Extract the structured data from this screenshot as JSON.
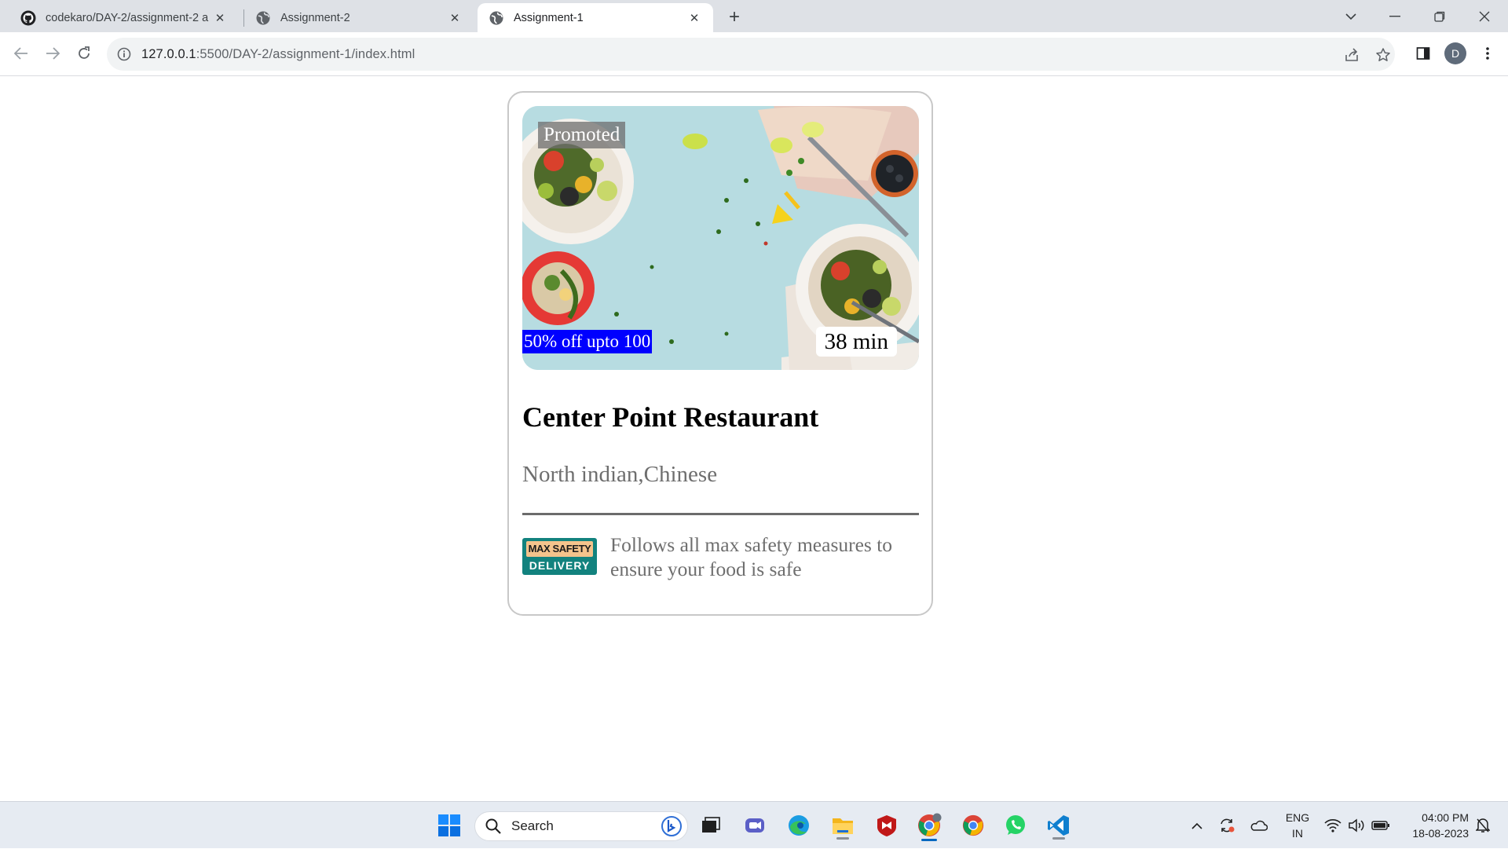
{
  "browser": {
    "tabs": [
      {
        "title": "codekaro/DAY-2/assignment-2 a",
        "icon": "github-icon",
        "active": false
      },
      {
        "title": "Assignment-2",
        "icon": "globe-icon",
        "active": false
      },
      {
        "title": "Assignment-1",
        "icon": "globe-icon",
        "active": true
      }
    ],
    "address": {
      "host": "127.0.0.1",
      "path": ":5500/DAY-2/assignment-1/index.html"
    },
    "profile_initial": "D"
  },
  "card": {
    "promoted_label": "Promoted",
    "offer_label": "50% off upto 100",
    "eta_label": "38 min",
    "restaurant_name": "Center Point Restaurant",
    "cuisines": "North indian,Chinese",
    "badge": {
      "top": "MAX SAFETY",
      "bottom": "DELIVERY"
    },
    "safety_text": "Follows all max safety measures to ensure your food is safe"
  },
  "colors": {
    "offer_bg": "#0000ff",
    "badge_teal": "#12827e",
    "badge_peach": "#f4c38c",
    "text_gray": "#6e6e6e"
  },
  "taskbar": {
    "search_label": "Search",
    "language": {
      "line1": "ENG",
      "line2": "IN"
    },
    "time": "04:00 PM",
    "date": "18-08-2023",
    "apps": [
      "windows-start-icon",
      "search-icon",
      "bing-icon",
      "task-view-icon",
      "meet-icon",
      "edge-icon",
      "file-explorer-icon",
      "mcafee-icon",
      "chrome-profile-icon",
      "chrome-icon",
      "whatsapp-icon",
      "vscode-icon"
    ]
  }
}
